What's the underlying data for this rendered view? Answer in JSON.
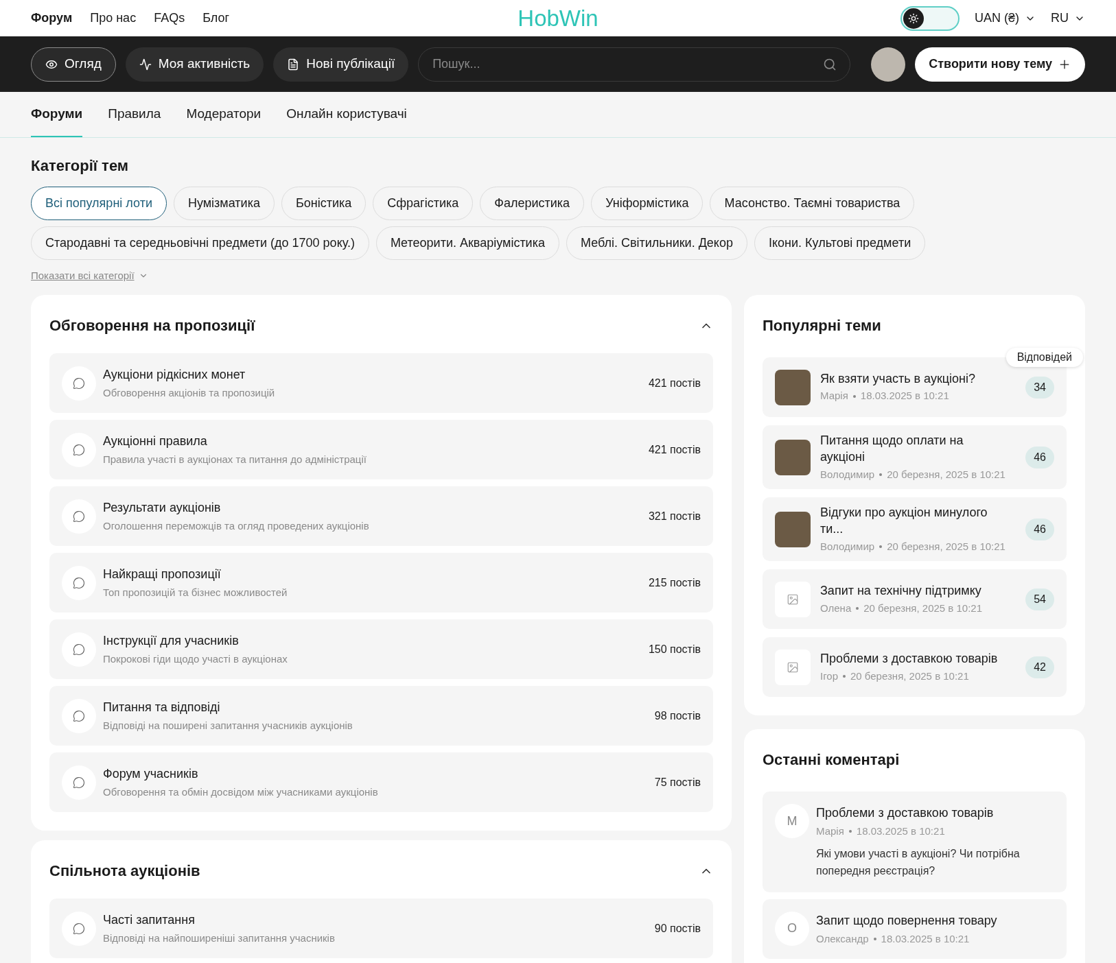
{
  "top_nav": [
    {
      "label": "Форум",
      "selected": true
    },
    {
      "label": "Про нас",
      "selected": false
    },
    {
      "label": "FAQs",
      "selected": false
    },
    {
      "label": "Блог",
      "selected": false
    }
  ],
  "logo": "HobWin",
  "theme_toggle": {
    "dark": false
  },
  "currency": "UAN (₴)",
  "language": "RU",
  "toolbar": {
    "tabs": [
      {
        "label": "Огляд",
        "kind": "eye",
        "selected": true
      },
      {
        "label": "Моя активність",
        "kind": "activity",
        "selected": false
      },
      {
        "label": "Нові публікації",
        "kind": "document",
        "selected": false
      }
    ],
    "search": {
      "placeholder": "Пошук..."
    },
    "create_button": "Створити нову тему"
  },
  "sub_tabs": [
    {
      "label": "Форуми",
      "selected": true
    },
    {
      "label": "Правила",
      "selected": false
    },
    {
      "label": "Модератори",
      "selected": false
    },
    {
      "label": "Онлайн користувачі",
      "selected": false
    }
  ],
  "categories": {
    "title": "Категорії тем",
    "chips": [
      {
        "label": "Всі популярні лоти",
        "selected": true
      },
      {
        "label": "Нумізматика",
        "selected": false
      },
      {
        "label": "Боністика",
        "selected": false
      },
      {
        "label": "Сфрагістика",
        "selected": false
      },
      {
        "label": "Фалеристика",
        "selected": false
      },
      {
        "label": "Уніформістика",
        "selected": false
      },
      {
        "label": "Масонство. Таємні товариства",
        "selected": false
      },
      {
        "label": "Стародавні та середньовічні предмети (до 1700 року.)",
        "selected": false
      },
      {
        "label": "Метеорити. Акваріумістика",
        "selected": false
      },
      {
        "label": "Меблі. Світильники. Декор",
        "selected": false
      },
      {
        "label": "Ікони. Культові предмети",
        "selected": false
      }
    ],
    "show_all": "Показати всі категорії"
  },
  "sections": [
    {
      "title": "Обговорення на пропозиції",
      "expanded": true,
      "forums": [
        {
          "name": "Аукціони рідкісних монет",
          "description": "Обговорення акціонів та пропозицій",
          "posts": "421 постів"
        },
        {
          "name": "Аукціонні правила",
          "description": "Правила участі в аукціонах та питання до адміністрації",
          "posts": "421 постів"
        },
        {
          "name": "Результати аукціонів",
          "description": "Оголошення переможців та огляд проведених аукціонів",
          "posts": "321 постів"
        },
        {
          "name": "Найкращі пропозиції",
          "description": "Топ пропозицій та бізнес можливостей",
          "posts": "215 постів"
        },
        {
          "name": "Інструкції для учасників",
          "description": "Покрокові гіди щодо участі в аукціонах",
          "posts": "150 постів"
        },
        {
          "name": "Питання та відповіді",
          "description": "Відповіді на поширені запитання учасників аукціонів",
          "posts": "98 постів"
        },
        {
          "name": "Форум учасників",
          "description": "Обговорення та обмін досвідом між учасниками аукціонів",
          "posts": "75 постів"
        }
      ]
    },
    {
      "title": "Спільнота аукціонів",
      "expanded": true,
      "forums": [
        {
          "name": "Часті запитання",
          "description": "Відповіді на найпоширеніші запитання учасників",
          "posts": "90 постів"
        }
      ]
    }
  ],
  "popular": {
    "title": "Популярні теми",
    "tooltip": "Відповідей",
    "topics": [
      {
        "kind": "photo",
        "title": "Як взяти участь в аукціоні?",
        "author": "Марія",
        "date": "18.03.2025 в 10:21",
        "replies": "34"
      },
      {
        "kind": "photo",
        "title": "Питання щодо оплати на аукціоні",
        "author": "Володимир",
        "date": "20 березня, 2025 в 10:21",
        "replies": "46"
      },
      {
        "kind": "photo",
        "title": "Відгуки про аукціон минулого ти...",
        "author": "Володимир",
        "date": "20 березня, 2025 в 10:21",
        "replies": "46"
      },
      {
        "kind": "placeholder",
        "title": "Запит на технічну підтримку",
        "author": "Олена",
        "date": "20 березня, 2025 в 10:21",
        "replies": "54"
      },
      {
        "kind": "placeholder",
        "title": "Проблеми з доставкою товарів",
        "author": "Ігор",
        "date": "20 березня, 2025 в 10:21",
        "replies": "42"
      }
    ]
  },
  "comments": {
    "title": "Останні коментарі",
    "items": [
      {
        "initial": "М",
        "title": "Проблеми з доставкою товарів",
        "author": "Марія",
        "date": "18.03.2025 в 10:21",
        "text": "Які умови участі в аукціоні? Чи потрібна попередня реєстрація?"
      },
      {
        "initial": "О",
        "title": "Запит щодо повернення товару",
        "author": "Олександр",
        "date": "18.03.2025 в 10:21"
      }
    ]
  }
}
